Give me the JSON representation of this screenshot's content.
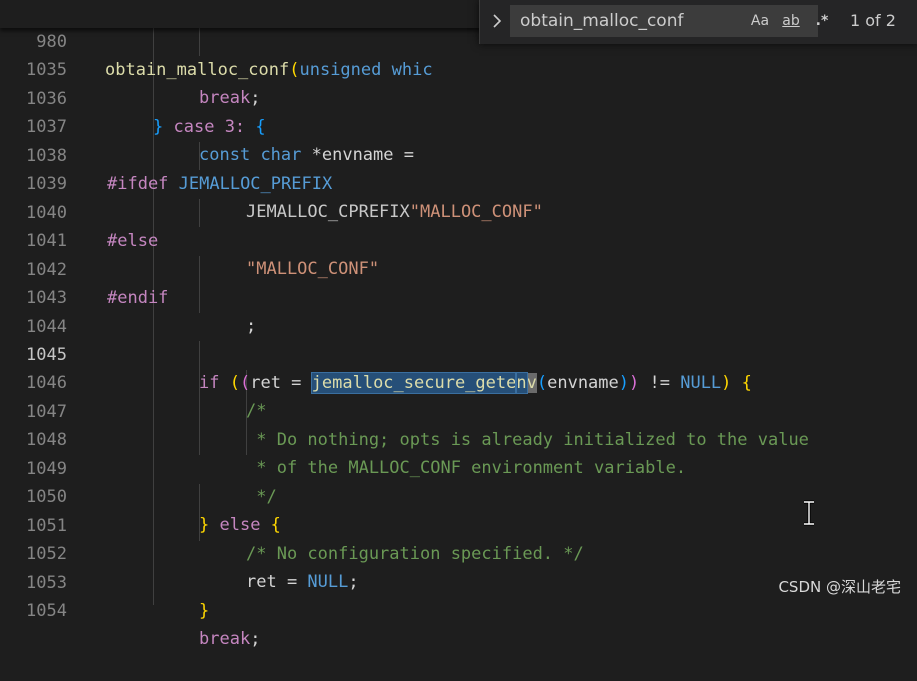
{
  "sticky": {
    "line_number": "980",
    "fn": "obtain_malloc_conf",
    "paren": "(",
    "kw": "unsigned",
    "rest": " whic"
  },
  "find": {
    "value": "obtain_malloc_conf",
    "opt_case": "Aa",
    "opt_word": "ab",
    "opt_regex": ".*",
    "count": "1 of 2"
  },
  "lines": {
    "l1035": {
      "n": "1035",
      "t1": "break",
      "t2": ";"
    },
    "l1036": {
      "n": "1036",
      "t1": "}",
      "t2": "case",
      "t3": " 3: ",
      "t4": "{"
    },
    "l1037": {
      "n": "1037",
      "t1": "const",
      "t2": "char",
      "t3": " *envname ="
    },
    "l1038": {
      "n": "1038",
      "t1": "#ifdef",
      "t2": " JEMALLOC_PREFIX"
    },
    "l1039": {
      "n": "1039",
      "t1": "JEMALLOC_CPREFIX",
      "t2": "\"MALLOC_CONF\""
    },
    "l1040": {
      "n": "1040",
      "t1": "#else"
    },
    "l1041": {
      "n": "1041",
      "t1": "\"MALLOC_CONF\""
    },
    "l1042": {
      "n": "1042",
      "t1": "#endif"
    },
    "l1043": {
      "n": "1043",
      "t1": ";"
    },
    "l1044": {
      "n": "1044"
    },
    "l1045": {
      "n": "1045",
      "t1": "if",
      "t2": " ",
      "t3": "(",
      "t4": "(",
      "t5": "ret = ",
      "t6": "jemalloc_secure_gete",
      "t7": "n",
      "t8": "v",
      "t9": "(",
      "t10": "envname",
      "t11": ")",
      "t12": ")",
      "t13": " != ",
      "t14": "NULL",
      "t15": ")",
      "t16": " ",
      "t17": "{"
    },
    "l1046": {
      "n": "1046",
      "t1": "/*"
    },
    "l1047": {
      "n": "1047",
      "t1": " * Do nothing; opts is already initialized to the value"
    },
    "l1048": {
      "n": "1048",
      "t1": " * of the MALLOC_CONF environment variable."
    },
    "l1049": {
      "n": "1049",
      "t1": " */"
    },
    "l1050": {
      "n": "1050",
      "t1": "}",
      "t2": " else ",
      "t3": "{"
    },
    "l1051": {
      "n": "1051",
      "t1": "/* No configuration specified. */"
    },
    "l1052": {
      "n": "1052",
      "t1": "ret = ",
      "t2": "NULL",
      "t3": ";"
    },
    "l1053": {
      "n": "1053",
      "t1": "}"
    },
    "l1054": {
      "n": "1054",
      "t1": "break",
      "t2": ";"
    }
  },
  "watermark": "CSDN @深山老宅",
  "icons": {
    "toggle": "chevron-right-icon",
    "cursor": "text-cursor-icon"
  }
}
